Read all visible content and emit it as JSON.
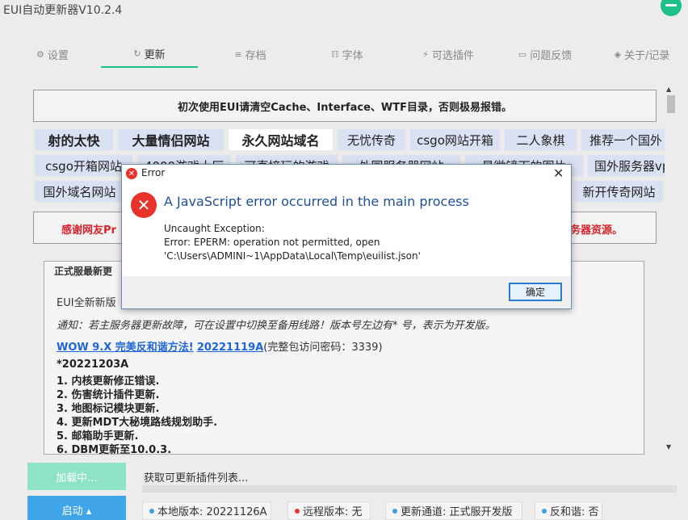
{
  "app": {
    "title": "EUI自动更新器V10.2.4",
    "accent": "#1dbf8b"
  },
  "tabs": [
    {
      "label": "设置",
      "icon": "gear-icon"
    },
    {
      "label": "更新",
      "icon": "refresh-icon",
      "active": true
    },
    {
      "label": "存档",
      "icon": "database-icon"
    },
    {
      "label": "字体",
      "icon": "font-icon"
    },
    {
      "label": "可选插件",
      "icon": "plug-icon"
    },
    {
      "label": "问题反馈",
      "icon": "comment-icon"
    },
    {
      "label": "关于/记录",
      "icon": "shield-icon"
    }
  ],
  "notice": "初次使用EUI请清空Cache、Interface、WTF目录，否则极易报错。",
  "links": {
    "row1": [
      "射的太快",
      "大量情侣网站",
      "永久网站域名",
      "无忧传奇",
      "csgo网站开箱",
      "二人象棋",
      "推荐一个国外"
    ],
    "row2": [
      "csgo开箱网站",
      "4000游戏大厅",
      "可直接玩的游戏",
      "外国服务器网站",
      "最微镜下的图片",
      "国外服务器vps"
    ],
    "row3": [
      "国外域名网站",
      "新开传奇网站"
    ]
  },
  "thanks": {
    "left": "感谢网友Pr",
    "right": "务器资源。"
  },
  "changelog": {
    "legend": "正式服最新更",
    "intro": "EUI全新新版",
    "notice": "通知：若主服务器更新故障，可在设置中切换至备用线路！版本号左边有* 号，表示为开发版。",
    "link1": "WOW 9.X 完美反和谐方法!",
    "link2": "20221119A",
    "link_note": "(完整包访问密码：3339)",
    "version": "*20221203A",
    "items": [
      "1. 内核更新修正错误.",
      "2. 伤害统计插件更新.",
      "3. 地图标记模块更新.",
      "4. 更新MDT大秘境路线规划助手.",
      "5. 邮箱助手更新.",
      "6. DBM更新至10.0.3."
    ]
  },
  "footer": {
    "load_label": "加载中...",
    "start_label": "启动 ▴",
    "status": "获取可更新插件列表...",
    "progress": 0,
    "chips": [
      {
        "text": "本地版本: 20221126A",
        "color": "#3aa0e8"
      },
      {
        "text": "远程版本: 无",
        "color": "#e8322b"
      },
      {
        "text": "更新通道: 正式服开发版",
        "color": "#3aa0e8"
      },
      {
        "text": "反和谐: 否",
        "color": "#3aa0e8"
      }
    ]
  },
  "dialog": {
    "title": "Error",
    "heading": "A JavaScript error occurred in the main process",
    "line1": "Uncaught Exception:",
    "line2": "Error: EPERM: operation not permitted, open",
    "line3": "'C:\\Users\\ADMINI~1\\AppData\\Local\\Temp\\euilist.json'",
    "ok_label": "确定"
  }
}
